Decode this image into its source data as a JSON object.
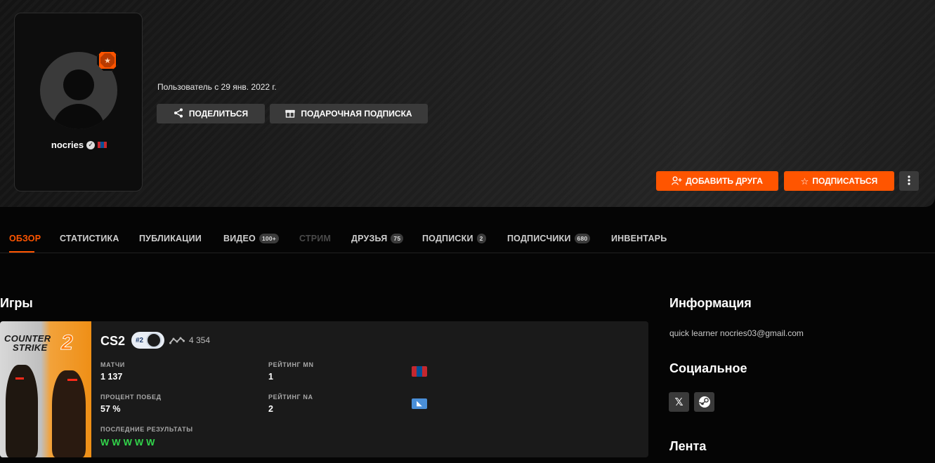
{
  "profile": {
    "nickname": "nocries",
    "member_since": "Пользователь с 29 янв. 2022 г.",
    "verified_icon": "verified-check-icon",
    "country_flag": "flag-mongolia-icon"
  },
  "actions": {
    "share": "ПОДЕЛИТЬСЯ",
    "gift": "ПОДАРОЧНАЯ ПОДПИСКА",
    "add_friend": "ДОБАВИТЬ ДРУГА",
    "subscribe": "ПОДПИСАТЬСЯ"
  },
  "tabs": [
    {
      "label": "ОБЗОР",
      "active": true
    },
    {
      "label": "СТАТИСТИКА"
    },
    {
      "label": "ПУБЛИКАЦИИ"
    },
    {
      "label": "ВИДЕО",
      "count": "100+"
    },
    {
      "label": "СТРИМ",
      "disabled": true
    },
    {
      "label": "ДРУЗЬЯ",
      "count": "75"
    },
    {
      "label": "ПОДПИСКИ",
      "count": "2"
    },
    {
      "label": "ПОДПИСЧИКИ",
      "count": "680"
    },
    {
      "label": "ИНВЕНТАРЬ"
    }
  ],
  "games": {
    "title": "Игры",
    "cs2": {
      "cover_line1": "COUNTER",
      "cover_line2": "STRIKE",
      "cover_num": "2",
      "name": "CS2",
      "rank": "#2",
      "elo": "4 354",
      "matches_label": "МАТЧИ",
      "matches": "1 137",
      "winrate_label": "ПРОЦЕНТ ПОБЕД",
      "winrate": "57 %",
      "recent_label": "ПОСЛЕДНИЕ РЕЗУЛЬТАТЫ",
      "recent": [
        "W",
        "W",
        "W",
        "W",
        "W"
      ],
      "rating_mn_label": "РЕЙТИНГ MN",
      "rating_mn": "1",
      "rating_na_label": "РЕЙТИНГ NA",
      "rating_na": "2"
    }
  },
  "sidebar": {
    "info_title": "Информация",
    "info_text": "quick learner nocries03@gmail.com",
    "social_title": "Социальное",
    "feed_title": "Лента"
  },
  "colors": {
    "accent": "#ff5500",
    "win": "#32d74b"
  }
}
